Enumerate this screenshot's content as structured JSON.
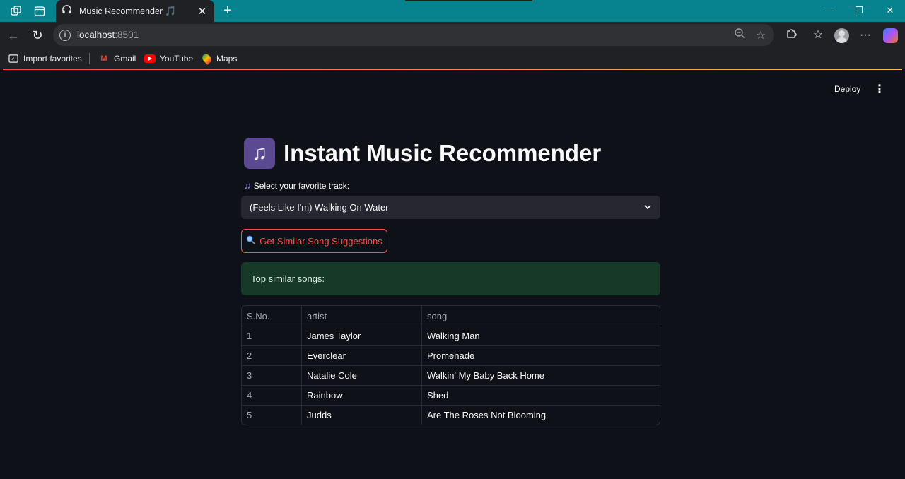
{
  "browser": {
    "tab_title": "Music Recommender",
    "tab_emoji": "🎵",
    "url_host": "localhost",
    "url_port": ":8501",
    "favorites": [
      {
        "label": "Import favorites",
        "icon": "import-favorites-icon"
      },
      {
        "label": "Gmail",
        "icon": "gmail-icon"
      },
      {
        "label": "YouTube",
        "icon": "youtube-icon"
      },
      {
        "label": "Maps",
        "icon": "maps-icon"
      }
    ]
  },
  "app": {
    "deploy_label": "Deploy",
    "title": "Instant Music Recommender",
    "title_icon": "🎶",
    "select_label": "Select your favorite track:",
    "select_label_icon": "🎵",
    "selected_track": "(Feels Like I'm) Walking On Water",
    "button_label": "Get Similar Song Suggestions",
    "button_icon": "🔍",
    "result_message": "Top similar songs:",
    "table": {
      "headers": [
        "S.No.",
        "artist",
        "song"
      ],
      "rows": [
        [
          "1",
          "James Taylor",
          "Walking Man"
        ],
        [
          "2",
          "Everclear",
          "Promenade"
        ],
        [
          "3",
          "Natalie Cole",
          "Walkin' My Baby Back Home"
        ],
        [
          "4",
          "Rainbow",
          "Shed"
        ],
        [
          "5",
          "Judds",
          "Are The Roses Not Blooming"
        ]
      ]
    }
  },
  "colors": {
    "tab_bar": "#06838f",
    "app_background": "#0e1117",
    "accent_red": "#ff4b4b",
    "success_bg": "#173928",
    "select_bg": "#262730"
  }
}
